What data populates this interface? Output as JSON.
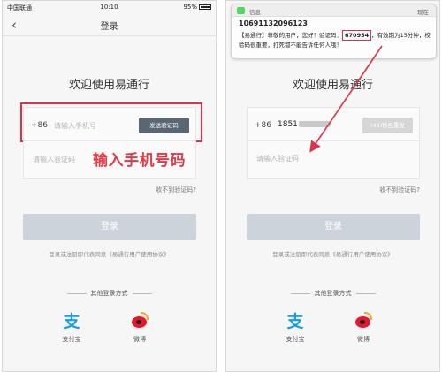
{
  "left": {
    "status": {
      "carrier": "中国联通",
      "time": "10:10",
      "battery": "95%"
    },
    "nav_title": "登录",
    "welcome": "欢迎使用易通行",
    "country_code": "+86",
    "phone_placeholder": "请输入手机号",
    "send_code_label": "发送验证码",
    "code_placeholder": "请输入验证码",
    "annotation": "输入手机号码",
    "no_code_link": "收不到验证码?",
    "login_label": "登录",
    "agreement": "登录或注册即代表同意《易通行用户使用协议》",
    "other_methods": "其他登录方式",
    "alipay_label": "支付宝",
    "weibo_label": "微博"
  },
  "right": {
    "notification": {
      "app": "信息",
      "time": "现在",
      "sender": "10691132096123",
      "body_prefix": "【易通行】尊敬的用户，您好！验证码：",
      "code": "670954",
      "body_suffix": "，有效期为15分钟，校验码很重要，打死都不能告诉任何人哦！"
    },
    "welcome": "欢迎使用易通行",
    "country_code": "+86",
    "phone_value": "1851",
    "resend_label": "(43)秒后重发",
    "code_placeholder": "请输入验证码",
    "no_code_link": "收不到验证码?",
    "login_label": "登录",
    "agreement": "登录或注册即代表同意《易通行用户使用协议》",
    "other_methods": "其他登录方式",
    "alipay_label": "支付宝",
    "weibo_label": "微博"
  },
  "icons": {
    "back": "chevron-left-icon",
    "alipay": "alipay-icon",
    "weibo": "weibo-icon",
    "message": "message-icon"
  },
  "colors": {
    "accent_red": "#d9344f",
    "send_button": "#5b6673",
    "login_disabled": "#cdd3db"
  }
}
